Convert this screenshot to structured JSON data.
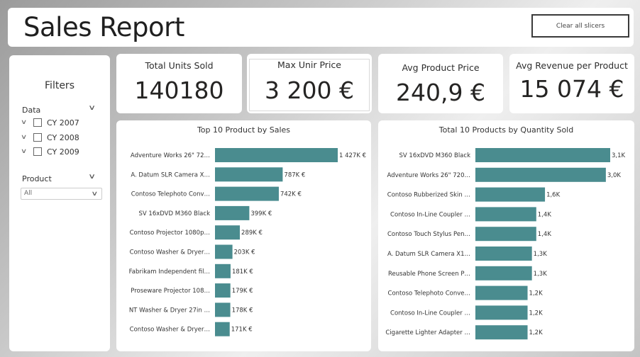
{
  "header": {
    "title": "Sales Report",
    "clear_button": "Clear all slicers"
  },
  "filters": {
    "title": "Filters",
    "data_slicer": {
      "title": "Data",
      "items": [
        "CY 2007",
        "CY 2008",
        "CY 2009"
      ]
    },
    "product_slicer": {
      "title": "Product",
      "selected": "All"
    }
  },
  "kpis": [
    {
      "title": "Total Units Sold",
      "value": "140180"
    },
    {
      "title": "Max Unir Price",
      "value": "3 200 €"
    },
    {
      "title": "Avg Product Price",
      "value": "240,9 €"
    },
    {
      "title": "Avg Revenue per Product",
      "value": "15 074 €"
    }
  ],
  "colors": {
    "bar": "#4a8c8f",
    "card": "#ffffff"
  },
  "chart_data": [
    {
      "type": "bar",
      "orientation": "horizontal",
      "title": "Top 10 Product by Sales",
      "categories": [
        "Adventure Works 26\" 72…",
        "A. Datum SLR Camera X…",
        "Contoso Telephoto Conv…",
        "SV 16xDVD M360 Black",
        "Contoso Projector 1080p…",
        "Contoso Washer & Dryer…",
        "Fabrikam Independent fil…",
        "Proseware Projector 108…",
        "NT Washer & Dryer 27in …",
        "Contoso Washer & Dryer…"
      ],
      "values": [
        1427,
        787,
        742,
        399,
        289,
        203,
        181,
        179,
        178,
        171
      ],
      "labels": [
        "1 427K €",
        "787K €",
        "742K €",
        "399K €",
        "289K €",
        "203K €",
        "181K €",
        "179K €",
        "178K €",
        "171K €"
      ],
      "xlim": [
        0,
        1427
      ]
    },
    {
      "type": "bar",
      "orientation": "horizontal",
      "title": "Total 10 Products by Quantity Sold",
      "categories": [
        "SV 16xDVD M360 Black",
        "Adventure Works 26\" 720…",
        "Contoso Rubberized Skin …",
        "Contoso In-Line Coupler …",
        "Contoso Touch Stylus Pen…",
        "A. Datum SLR Camera X1…",
        "Reusable Phone Screen P…",
        "Contoso Telephoto Conve…",
        "Contoso In-Line Coupler …",
        "Cigarette Lighter Adapter …"
      ],
      "values": [
        3.1,
        3.0,
        1.6,
        1.4,
        1.4,
        1.3,
        1.3,
        1.2,
        1.2,
        1.2
      ],
      "labels": [
        "3,1K",
        "3,0K",
        "1,6K",
        "1,4K",
        "1,4K",
        "1,3K",
        "1,3K",
        "1,2K",
        "1,2K",
        "1,2K"
      ],
      "xlim": [
        0,
        3.1
      ]
    }
  ]
}
